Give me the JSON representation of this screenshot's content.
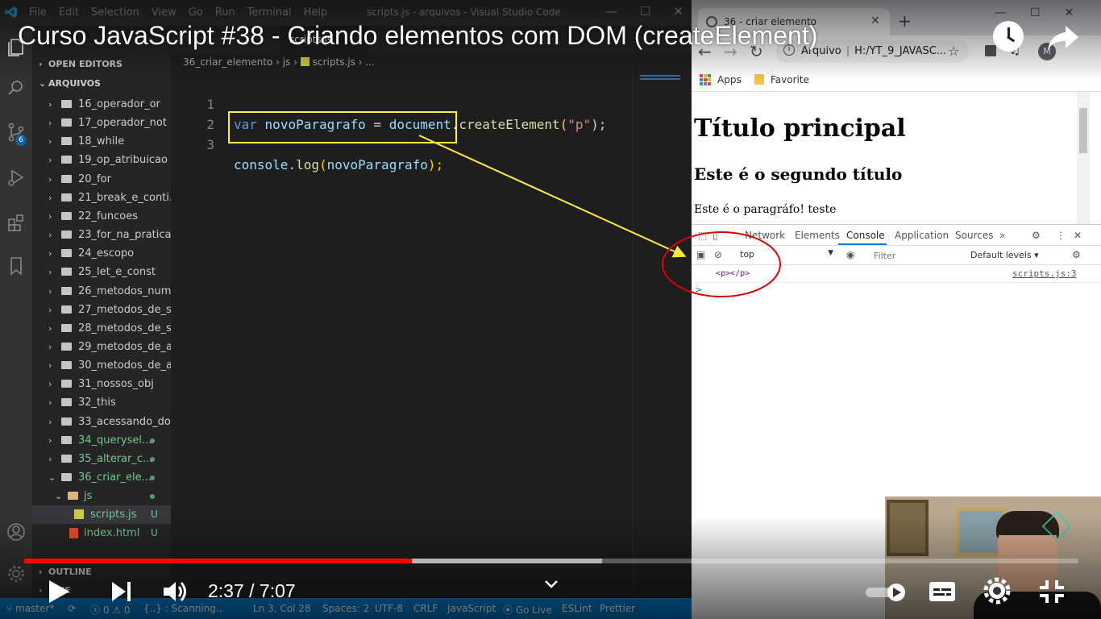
{
  "vscode": {
    "menu": [
      "File",
      "Edit",
      "Selection",
      "View",
      "Go",
      "Run",
      "Terminal",
      "Help"
    ],
    "window_title": "scripts.js - arquivos - Visual Studio Code",
    "window_controls": [
      "—",
      "☐",
      "✕"
    ],
    "scm_badge": "6",
    "open_editors_label": "OPEN EDITORS",
    "explorer_root": "ARQUIVOS",
    "tree": [
      {
        "label": "16_operador_or",
        "kind": "folder"
      },
      {
        "label": "17_operador_not",
        "kind": "folder"
      },
      {
        "label": "18_while",
        "kind": "folder"
      },
      {
        "label": "19_op_atribuicao",
        "kind": "folder"
      },
      {
        "label": "20_for",
        "kind": "folder"
      },
      {
        "label": "21_break_e_conti...",
        "kind": "folder"
      },
      {
        "label": "22_funcoes",
        "kind": "folder"
      },
      {
        "label": "23_for_na_pratica",
        "kind": "folder"
      },
      {
        "label": "24_escopo",
        "kind": "folder"
      },
      {
        "label": "25_let_e_const",
        "kind": "folder"
      },
      {
        "label": "26_metodos_num...",
        "kind": "folder"
      },
      {
        "label": "27_metodos_de_s...",
        "kind": "folder"
      },
      {
        "label": "28_metodos_de_s...",
        "kind": "folder"
      },
      {
        "label": "29_metodos_de_a...",
        "kind": "folder"
      },
      {
        "label": "30_metodos_de_a...",
        "kind": "folder"
      },
      {
        "label": "31_nossos_obj",
        "kind": "folder"
      },
      {
        "label": "32_this",
        "kind": "folder"
      },
      {
        "label": "33_acessando_dom",
        "kind": "folder"
      },
      {
        "label": "34_querysel...",
        "kind": "folder-modified"
      },
      {
        "label": "35_alterar_c...",
        "kind": "folder-modified"
      },
      {
        "label": "36_criar_ele...",
        "kind": "folder-open-modified"
      },
      {
        "label": "js",
        "kind": "subfolder"
      },
      {
        "label": "scripts.js",
        "kind": "js-file",
        "status": "U"
      },
      {
        "label": "index.html",
        "kind": "html-file",
        "status": "U"
      }
    ],
    "outline_label": "OUTLINE",
    "timeline_label": "LINE",
    "tab_label": "scripts.js",
    "breadcrumb": [
      "36_criar_elemento",
      "js",
      "scripts.js",
      "..."
    ],
    "code": {
      "line1_num": "1",
      "line2_num": "2",
      "line3_num": "3",
      "l1_kw": "var",
      "l1_var": "novoParagrafo",
      "l1_eq": " = ",
      "l1_obj": "document",
      "l1_dot": ".",
      "l1_fn": "createElement",
      "l1_open": "(",
      "l1_str": "\"p\"",
      "l1_close": ");",
      "l3_obj": "console",
      "l3_dot": ".",
      "l3_fn": "log",
      "l3_open": "(",
      "l3_arg": "novoParagrafo",
      "l3_close": ");"
    },
    "status": {
      "branch": "master*",
      "sync": "⟳",
      "errors": "0",
      "warnings": "0",
      "scanning": "{..} : Scanning..",
      "cursor": "Ln 3, Col 28",
      "spaces": "Spaces: 2",
      "encoding": "UTF-8",
      "eol": "CRLF",
      "language": "JavaScript",
      "golive": "Go Live",
      "eslint": "ESLint",
      "prettier": "Prettier"
    }
  },
  "chrome": {
    "tab_title": "36 - criar elemento",
    "tab_close": "✕",
    "new_tab": "+",
    "window_controls": [
      "—",
      "☐",
      "✕"
    ],
    "url_scheme": "Arquivo",
    "url_path": "H:/YT_9_JAVASC...",
    "profile_initial": "M",
    "bookmarks": {
      "apps": "Apps",
      "favorite": "Favorite"
    },
    "page": {
      "h1": "Título principal",
      "h2": "Este é o segundo título",
      "p": "Este é o paragráfo! teste"
    },
    "devtools": {
      "tabs": [
        "Network",
        "Elements",
        "Console",
        "Application",
        "Sources",
        "»"
      ],
      "active_tab": "Console",
      "context": "top",
      "filter_placeholder": "Filter",
      "levels": "Default levels ▾",
      "log_value": "<p></p>",
      "log_source": "scripts.js:3",
      "prompt": ">"
    }
  },
  "youtube": {
    "title": "Curso JavaScript #38 - Criando elementos com DOM (createElement)",
    "time": "2:37 / 7:07",
    "played_fraction": 0.368,
    "buffered_fraction": 0.548
  },
  "colors": {
    "vscode_status_bar": "#007acc",
    "highlight_box": "#ffeb3b",
    "annotation_circle": "#e00000",
    "progress_played": "#ff0000"
  }
}
